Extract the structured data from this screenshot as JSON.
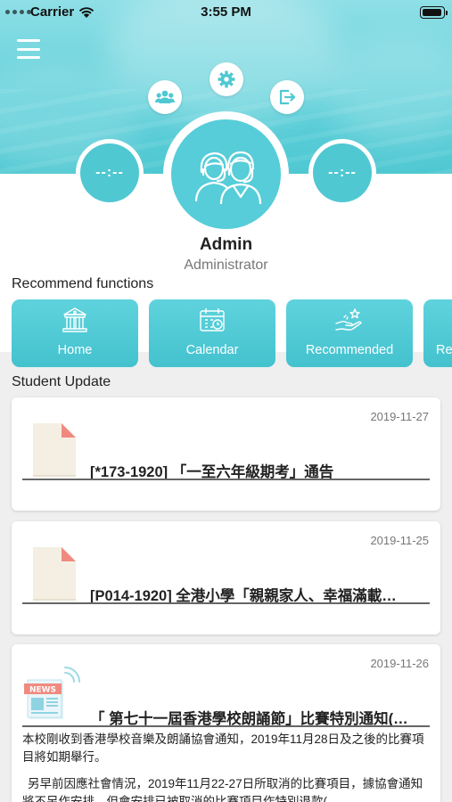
{
  "status_bar": {
    "carrier": "Carrier",
    "time": "3:55 PM"
  },
  "header": {
    "left_time": "--:--",
    "right_time": "--:--"
  },
  "user": {
    "name": "Admin",
    "role": "Administrator"
  },
  "recommend": {
    "title": "Recommend functions",
    "items": [
      {
        "label": "Home",
        "icon": "building-icon"
      },
      {
        "label": "Calendar",
        "icon": "calendar-icon"
      },
      {
        "label": "Recommended",
        "icon": "hand-star-icon"
      },
      {
        "label": "Re",
        "icon": ""
      }
    ]
  },
  "updates": {
    "title": "Student Update",
    "items": [
      {
        "date": "2019-11-27",
        "title": "[*173-1920] 「一至六年級期考」通告",
        "icon": "document-icon"
      },
      {
        "date": "2019-11-25",
        "title": "[P014-1920] 全港小學「親親家人、幸福滿載…",
        "icon": "document-icon"
      },
      {
        "date": "2019-11-26",
        "title": "「 第七十一屆香港學校朗誦節」比賽特別通知(…",
        "icon": "news-icon",
        "body_1": "本校剛收到香港學校音樂及朗誦協會通知，2019年11月28日及之後的比賽項目將如期舉行。",
        "body_2": "另早前因應社會情況，2019年11月22-27日所取消的比賽項目，據協會通知將不另作安排，但會安排已被取消的比賽項目作特別退款("
      }
    ]
  },
  "colors": {
    "accent": "#4fc8d2",
    "tile": "#4ec9d4"
  }
}
